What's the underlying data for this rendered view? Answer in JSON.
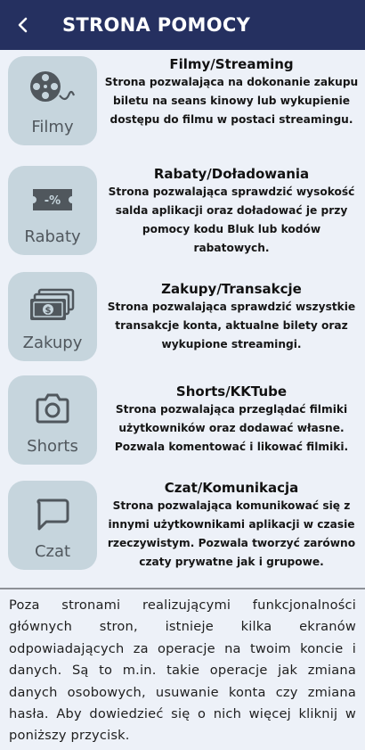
{
  "header": {
    "title": "STRONA POMOCY",
    "back_icon": "chevron-left-icon",
    "background": "#253060"
  },
  "items": [
    {
      "tile_label": "Filmy",
      "icon": "film-reel-icon",
      "title": "Filmy/Streaming",
      "description": "Strona pozwalająca na dokonanie zakupu biletu na seans kinowy lub wykupienie dostępu do filmu w postaci streamingu."
    },
    {
      "tile_label": "Rabaty",
      "icon": "discount-ticket-icon",
      "title": "Rabaty/Doładowania",
      "description": "Strona pozwalająca sprawdzić wysokość salda aplikacji oraz doładować je przy pomocy kodu Bluk lub kodów rabatowych."
    },
    {
      "tile_label": "Zakupy",
      "icon": "money-stack-icon",
      "title": "Zakupy/Transakcje",
      "description": "Strona pozwalająca sprawdzić wszystkie transakcje konta, aktualne bilety oraz wykupione streamingi."
    },
    {
      "tile_label": "Shorts",
      "icon": "camera-icon",
      "title": "Shorts/KKTube",
      "description": "Strona pozwalająca przeglądać filmiki użytkowników oraz dodawać własne. Pozwala komentować i likować filmiki."
    },
    {
      "tile_label": "Czat",
      "icon": "chat-bubble-icon",
      "title": "Czat/Komunikacja",
      "description": "Strona pozwalająca komunikować się z innymi użytkownikami aplikacji w czasie rzeczywistym. Pozwala tworzyć zarówno czaty prywatne jak i grupowe."
    }
  ],
  "info_text": "Poza stronami realizującymi funkcjonalności głównych stron, istnieje kilka ekranów odpowiadających za operacje na twoim koncie i danych. Są to m.in. takie operacje jak zmiana danych osobowych, usuwanie konta czy zmiana hasła. Aby dowiedzieć się o nich więcej kliknij w poniższy przycisk."
}
